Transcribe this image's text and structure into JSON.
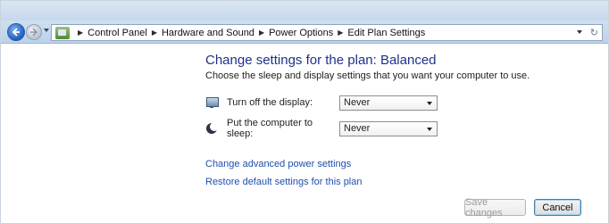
{
  "addressbar": {
    "crumbs": [
      "Control Panel",
      "Hardware and Sound",
      "Power Options",
      "Edit Plan Settings"
    ]
  },
  "main": {
    "title": "Change settings for the plan: Balanced",
    "subtitle": "Choose the sleep and display settings that you want your computer to use.",
    "settings": [
      {
        "label": "Turn off the display:",
        "value": "Never",
        "icon": "monitor-icon"
      },
      {
        "label": "Put the computer to sleep:",
        "value": "Never",
        "icon": "moon-icon"
      }
    ],
    "links": {
      "advanced": "Change advanced power settings",
      "restore": "Restore default settings for this plan"
    }
  },
  "footer": {
    "save_label": "Save changes",
    "cancel_label": "Cancel"
  },
  "colors": {
    "title": "#1e3287",
    "link": "#1d4fb0"
  }
}
